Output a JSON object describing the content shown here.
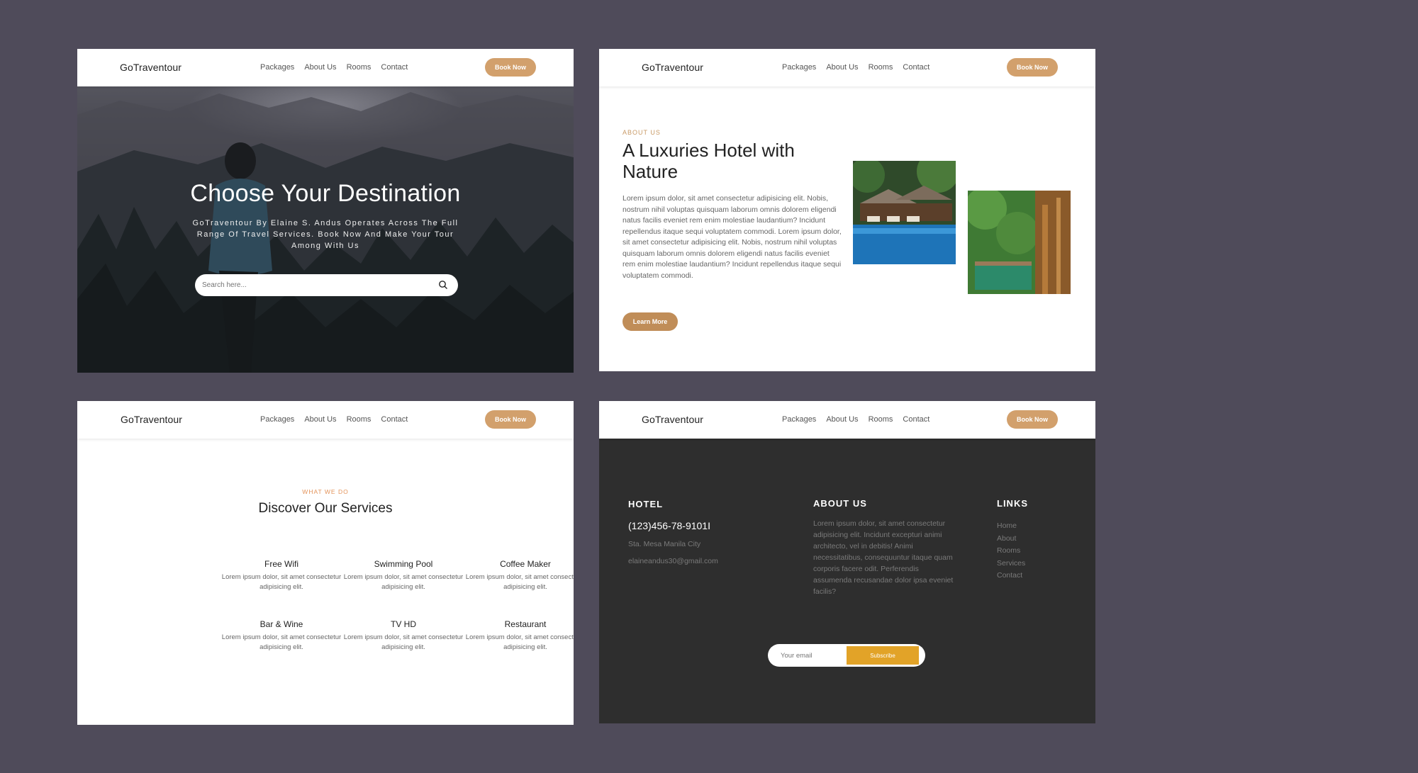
{
  "nav": {
    "logo": "GoTraventour",
    "links": [
      "Packages",
      "About Us",
      "Rooms",
      "Contact"
    ],
    "book_label": "Book Now"
  },
  "hero": {
    "title": "Choose Your Destination",
    "subtitle": "GoTraventour By Elaine S. Andus Operates Across The Full Range Of Travel Services. Book Now And Make Your Tour Among With Us",
    "search_placeholder": "Search here..."
  },
  "about": {
    "eyebrow": "ABOUT US",
    "title": "A Luxuries Hotel with Nature",
    "body": "Lorem ipsum dolor, sit amet consectetur adipisicing elit. Nobis, nostrum nihil voluptas quisquam laborum omnis dolorem eligendi natus facilis eveniet rem enim molestiae laudantium? Incidunt repellendus itaque sequi voluptatem commodi. Lorem ipsum dolor, sit amet consectetur adipisicing elit. Nobis, nostrum nihil voluptas quisquam laborum omnis dolorem eligendi natus facilis eveniet rem enim molestiae laudantium? Incidunt repellendus itaque sequi voluptatem commodi.",
    "learn_label": "Learn More"
  },
  "services": {
    "eyebrow": "WHAT WE DO",
    "title": "Discover Our Services",
    "items": [
      {
        "name": "Free Wifi",
        "desc": "Lorem ipsum dolor, sit amet consectetur adipisicing elit."
      },
      {
        "name": "Swimming Pool",
        "desc": "Lorem ipsum dolor, sit amet consectetur adipisicing elit."
      },
      {
        "name": "Coffee Maker",
        "desc": "Lorem ipsum dolor, sit amet consectetur adipisicing elit."
      },
      {
        "name": "Bar & Wine",
        "desc": "Lorem ipsum dolor, sit amet consectetur adipisicing elit."
      },
      {
        "name": "TV HD",
        "desc": "Lorem ipsum dolor, sit amet consectetur adipisicing elit."
      },
      {
        "name": "Restaurant",
        "desc": "Lorem ipsum dolor, sit amet consectetur adipisicing elit."
      }
    ]
  },
  "footer": {
    "hotel_heading": "HOTEL",
    "phone": "(123)456-78-9101I",
    "address": "Sta. Mesa Manila City",
    "email": "elaineandus30@gmail.com",
    "about_heading": "ABOUT US",
    "about_text": "Lorem ipsum dolor, sit amet consectetur adipisicing elit. Incidunt excepturi animi architecto, vel in debitis! Animi necessitatibus, consequuntur itaque quam corporis facere odit. Perferendis assumenda recusandae dolor ipsa eveniet facilis?",
    "links_heading": "LINKS",
    "links": [
      "Home",
      "About",
      "Rooms",
      "Services",
      "Contact"
    ],
    "email_placeholder": "Your email",
    "subscribe_label": "Subscribe"
  },
  "colors": {
    "page_bg": "#4f4b5a",
    "accent": "#d2a06c",
    "subscribe": "#e2a328",
    "footer_bg": "#2e2e2e"
  },
  "icons": [
    "search-icon"
  ]
}
